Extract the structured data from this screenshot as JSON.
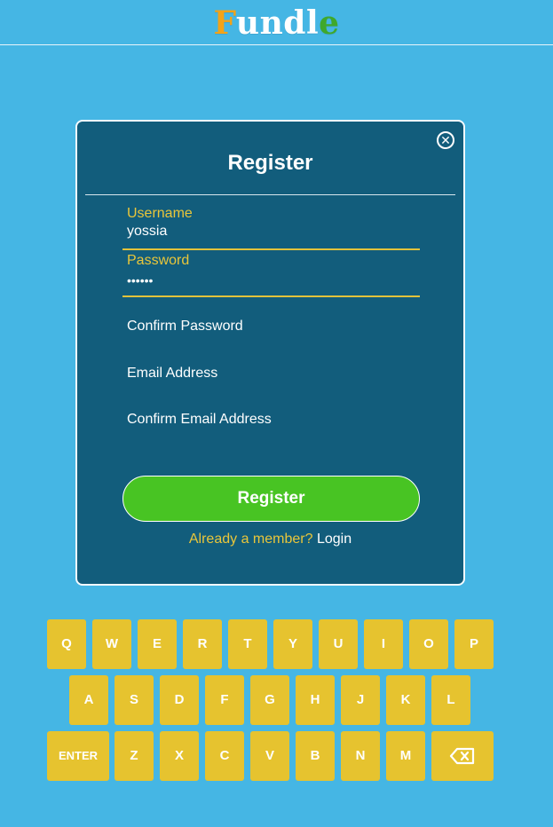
{
  "logo": {
    "letters": [
      {
        "char": "F",
        "color": "#f2a318"
      },
      {
        "char": "u",
        "color": "#ffffff"
      },
      {
        "char": "n",
        "color": "#ffffff"
      },
      {
        "char": "d",
        "color": "#ffffff"
      },
      {
        "char": "l",
        "color": "#ffffff"
      },
      {
        "char": "e",
        "color": "#3fa82c"
      }
    ]
  },
  "modal": {
    "title": "Register",
    "close_icon": "close-circle-icon",
    "username_label": "Username",
    "username_value": "yossia",
    "password_label": "Password",
    "password_value": "••••••",
    "confirm_password_placeholder": "Confirm Password",
    "email_placeholder": "Email Address",
    "confirm_email_placeholder": "Confirm Email Address",
    "register_button": "Register",
    "already_member": "Already a member?",
    "login_link": "Login"
  },
  "keyboard": {
    "row1": [
      "Q",
      "W",
      "E",
      "R",
      "T",
      "Y",
      "U",
      "I",
      "O",
      "P"
    ],
    "row2": [
      "A",
      "S",
      "D",
      "F",
      "G",
      "H",
      "J",
      "K",
      "L"
    ],
    "row3_enter": "ENTER",
    "row3": [
      "Z",
      "X",
      "C",
      "V",
      "B",
      "N",
      "M"
    ],
    "backspace_icon": "backspace-icon"
  },
  "colors": {
    "background": "#45b6e4",
    "modal": "#125d7c",
    "accent": "#e9c63a",
    "button_green": "#48c423",
    "key": "#e6c32f"
  }
}
